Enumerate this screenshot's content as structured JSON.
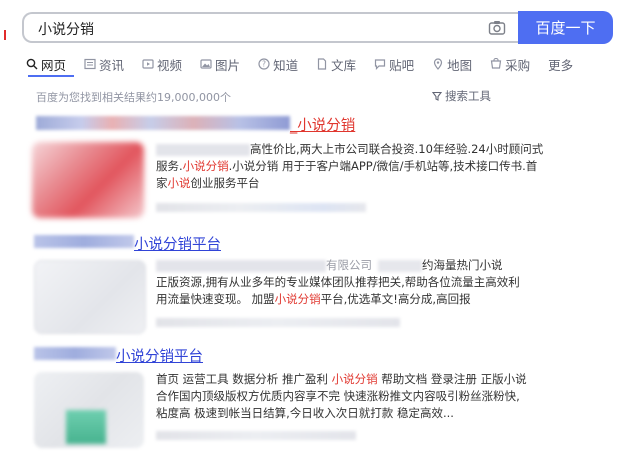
{
  "search": {
    "query": "小说分销",
    "button_label": "百度一下"
  },
  "tabs": [
    {
      "label": "网页",
      "icon": "search-icon"
    },
    {
      "label": "资讯",
      "icon": "news-icon"
    },
    {
      "label": "视频",
      "icon": "video-icon"
    },
    {
      "label": "图片",
      "icon": "image-icon"
    },
    {
      "label": "知道",
      "icon": "question-icon"
    },
    {
      "label": "文库",
      "icon": "document-icon"
    },
    {
      "label": "贴吧",
      "icon": "tieba-icon"
    },
    {
      "label": "地图",
      "icon": "map-icon"
    },
    {
      "label": "采购",
      "icon": "purchase-icon"
    },
    {
      "label": "更多",
      "icon": ""
    }
  ],
  "result_count": "百度为您找到相关结果约19,000,000个",
  "search_tools": "搜索工具",
  "results": [
    {
      "title_suffix": "_小说分销",
      "snippet": {
        "l1": "高性价比,两大上市公司联合投资.10年经验.24小时顾问式",
        "l2_a": "服务.",
        "l2_hl": "小说分销",
        "l2_b": ".小说分销 用于于客户端APP/微信/手机站等,技术接口传书.首",
        "l3_a": "家",
        "l3_hl": "小说",
        "l3_b": "创业服务平台"
      }
    },
    {
      "title_hl": "小说分销",
      "title_rest": "平台",
      "snippet": {
        "l1_a": "有限公司",
        "l1_b": "约海量热门小说",
        "l2": "正版资源,拥有从业多年的专业媒体团队推荐把关,帮助各位流量主高效利",
        "l3_a": "用流量快速变现。 加盟",
        "l3_hl": "小说分销",
        "l3_b": "平台,优选革文!高分成,高回报"
      }
    },
    {
      "title_hl": "小说分销",
      "title_rest": "平台",
      "snippet": {
        "l1_a": "首页 运营工具 数据分析 推广盈利 ",
        "l1_hl": "小说分销",
        "l1_b": " 帮助文档 登录注册 正版小说",
        "l2": "合作国内顶级版权方优质内容享不完 快速涨粉推文内容吸引粉丝涨粉快,",
        "l3": "粘度高 极速到帐当日结算,今日收入次日就打款 稳定高效..."
      }
    }
  ]
}
